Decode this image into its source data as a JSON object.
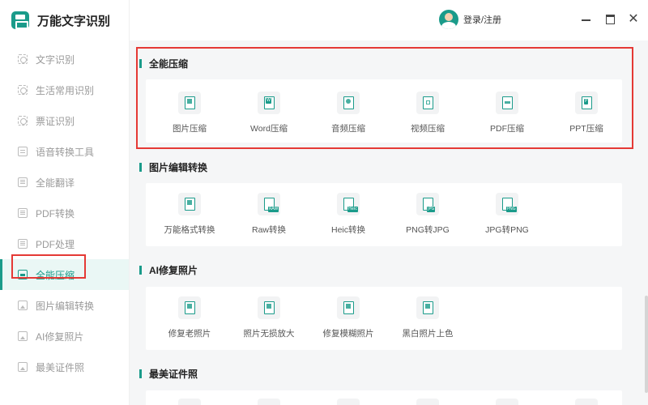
{
  "app": {
    "name": "万能文字识别"
  },
  "header": {
    "login_label": "登录/注册",
    "close_glyph": "✕"
  },
  "sidebar": {
    "items": [
      {
        "label": "文字识别",
        "icon": "scan-icon",
        "active": false
      },
      {
        "label": "生活常用识别",
        "icon": "scan-icon",
        "active": false
      },
      {
        "label": "票证识别",
        "icon": "scan-icon",
        "active": false
      },
      {
        "label": "语音转换工具",
        "icon": "voice-icon",
        "active": false
      },
      {
        "label": "全能翻译",
        "icon": "translate-icon",
        "active": false
      },
      {
        "label": "PDF转换",
        "icon": "pdf-icon",
        "active": false
      },
      {
        "label": "PDF处理",
        "icon": "pdf-icon",
        "active": false
      },
      {
        "label": "全能压缩",
        "icon": "compress-icon",
        "active": true
      },
      {
        "label": "图片编辑转换",
        "icon": "image-icon",
        "active": false
      },
      {
        "label": "AI修复照片",
        "icon": "image-icon",
        "active": false
      },
      {
        "label": "最美证件照",
        "icon": "id-photo-icon",
        "active": false
      }
    ]
  },
  "sections": [
    {
      "title": "全能压缩",
      "tools": [
        {
          "label": "图片压缩",
          "icon": "image-compress-icon",
          "tag": ""
        },
        {
          "label": "Word压缩",
          "icon": "word-compress-icon",
          "tag": "W"
        },
        {
          "label": "音频压缩",
          "icon": "audio-compress-icon",
          "tag": ""
        },
        {
          "label": "视频压缩",
          "icon": "video-compress-icon",
          "tag": ""
        },
        {
          "label": "PDF压缩",
          "icon": "pdf-compress-icon",
          "tag": ""
        },
        {
          "label": "PPT压缩",
          "icon": "ppt-compress-icon",
          "tag": "P"
        }
      ]
    },
    {
      "title": "图片编辑转换",
      "tools": [
        {
          "label": "万能格式转换",
          "icon": "format-convert-icon",
          "tag": ""
        },
        {
          "label": "Raw转换",
          "icon": "raw-convert-icon",
          "tag": "RAW"
        },
        {
          "label": "Heic转换",
          "icon": "heic-convert-icon",
          "tag": "Heic"
        },
        {
          "label": "PNG转JPG",
          "icon": "png-to-jpg-icon",
          "tag": "JPG"
        },
        {
          "label": "JPG转PNG",
          "icon": "jpg-to-png-icon",
          "tag": "PNG"
        }
      ]
    },
    {
      "title": "AI修复照片",
      "tools": [
        {
          "label": "修复老照片",
          "icon": "restore-old-photo-icon",
          "tag": ""
        },
        {
          "label": "照片无损放大",
          "icon": "upscale-photo-icon",
          "tag": ""
        },
        {
          "label": "修复模糊照片",
          "icon": "deblur-photo-icon",
          "tag": ""
        },
        {
          "label": "黑白照片上色",
          "icon": "colorize-photo-icon",
          "tag": ""
        }
      ]
    },
    {
      "title": "最美证件照",
      "tools": []
    }
  ],
  "colors": {
    "accent": "#1a9b8a",
    "highlight": "#e53935"
  }
}
